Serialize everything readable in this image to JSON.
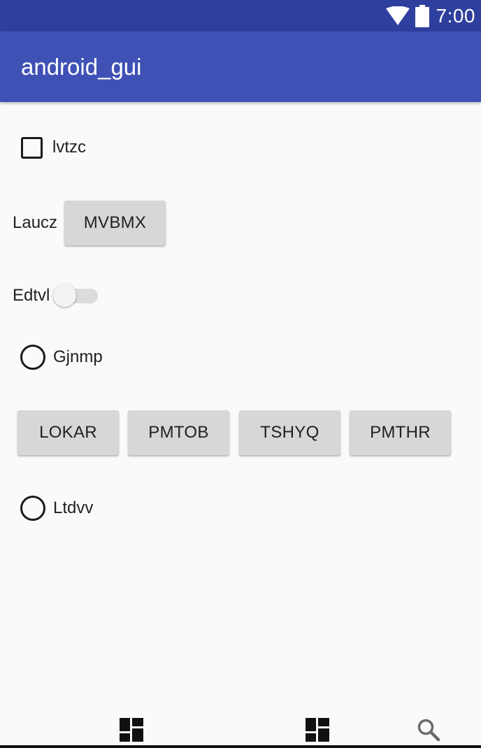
{
  "status_bar": {
    "time": "7:00",
    "icons": [
      "wifi-icon",
      "battery-icon"
    ]
  },
  "app_bar": {
    "title": "android_gui"
  },
  "checkbox": {
    "label": "lvtzc",
    "checked": false
  },
  "labeled_button": {
    "label": "Laucz",
    "button_label": "MVBMX"
  },
  "switch": {
    "label": "Edtvl",
    "on": false
  },
  "radio_1": {
    "label": "Gjnmp",
    "selected": false
  },
  "button_row": {
    "buttons": [
      "LOKAR",
      "PMTOB",
      "TSHYQ",
      "PMTHR"
    ]
  },
  "radio_2": {
    "label": "Ltdvv",
    "selected": false
  },
  "bottom_nav": {
    "icons": [
      "dashboard-icon",
      "dashboard-icon",
      "search-icon"
    ]
  },
  "colors": {
    "status_bar": "#2f3f9e",
    "app_bar": "#3f51b5",
    "background": "#fafafa",
    "button": "#d6d7d7"
  }
}
